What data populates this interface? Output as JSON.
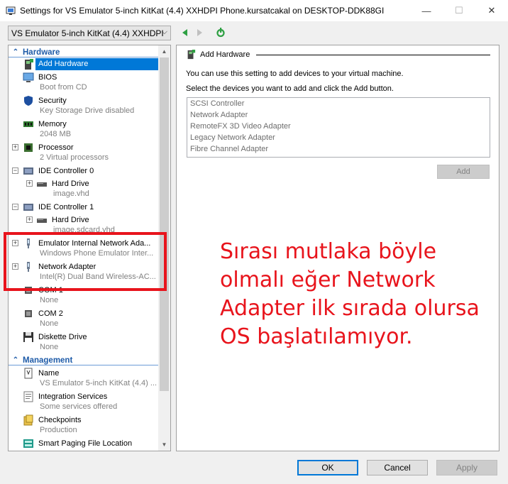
{
  "window": {
    "title": "Settings for VS Emulator 5-inch KitKat (4.4) XXHDPI Phone.kursatcakal on DESKTOP-DDK88GI",
    "minimize_glyph": "—",
    "maximize_glyph": "☐",
    "close_glyph": "✕"
  },
  "toolbar": {
    "vm_selected": "VS Emulator 5-inch KitKat (4.4) XXHDPI",
    "chevron": "⌵"
  },
  "hardware": {
    "header": "Hardware",
    "items": [
      {
        "label": "Add Hardware",
        "sub": ""
      },
      {
        "label": "BIOS",
        "sub": "Boot from CD"
      },
      {
        "label": "Security",
        "sub": "Key Storage Drive disabled"
      },
      {
        "label": "Memory",
        "sub": "2048 MB"
      },
      {
        "label": "Processor",
        "sub": "2 Virtual processors"
      },
      {
        "label": "IDE Controller 0",
        "sub": ""
      },
      {
        "label": "Hard Drive",
        "sub": "image.vhd"
      },
      {
        "label": "IDE Controller 1",
        "sub": ""
      },
      {
        "label": "Hard Drive",
        "sub": "image.sdcard.vhd"
      },
      {
        "label": "Emulator Internal Network Ada...",
        "sub": "Windows Phone Emulator Inter..."
      },
      {
        "label": "Network Adapter",
        "sub": "Intel(R) Dual Band Wireless-AC..."
      },
      {
        "label": "COM 1",
        "sub": "None"
      },
      {
        "label": "COM 2",
        "sub": "None"
      },
      {
        "label": "Diskette Drive",
        "sub": "None"
      }
    ]
  },
  "management": {
    "header": "Management",
    "items": [
      {
        "label": "Name",
        "sub": "VS Emulator 5-inch KitKat (4.4) ..."
      },
      {
        "label": "Integration Services",
        "sub": "Some services offered"
      },
      {
        "label": "Checkpoints",
        "sub": "Production"
      },
      {
        "label": "Smart Paging File Location",
        "sub": ""
      }
    ]
  },
  "main": {
    "header": "Add Hardware",
    "line1": "You can use this setting to add devices to your virtual machine.",
    "line2": "Select the devices you want to add and click the Add button.",
    "devices": [
      "SCSI Controller",
      "Network Adapter",
      "RemoteFX 3D Video Adapter",
      "Legacy Network Adapter",
      "Fibre Channel Adapter"
    ],
    "add_label": "Add"
  },
  "footer": {
    "ok": "OK",
    "cancel": "Cancel",
    "apply": "Apply"
  },
  "annotation": {
    "lines": [
      "Sırası mutlaka böyle",
      "olmalı eğer Network",
      "Adapter ilk sırada olursa",
      "OS başlatılamıyor."
    ],
    "color": "#e8141c"
  },
  "colors": {
    "selection": "#0078d7",
    "section_header": "#1e5ba8"
  }
}
